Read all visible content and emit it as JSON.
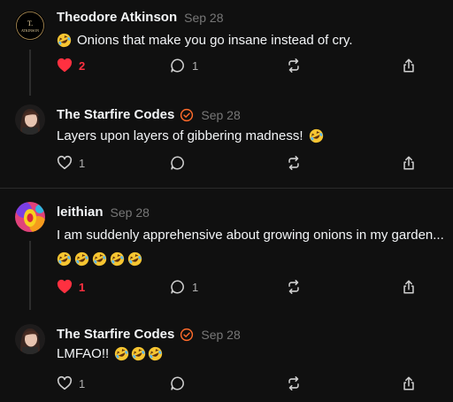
{
  "posts": [
    {
      "author": "Theodore Atkinson",
      "date": "Sep 28",
      "verified": false,
      "avatar": "ta-monogram-avatar",
      "text_prefix_emoji": true,
      "text": "Onions that make you go insane instead of cry.",
      "likes": "2",
      "liked": true,
      "replies": "1",
      "reposts": "",
      "extra_emojis": 0
    },
    {
      "author": "The Starfire Codes",
      "date": "Sep 28",
      "verified": true,
      "avatar": "woman-photo-avatar",
      "text_prefix_emoji": false,
      "text": "Layers upon layers of gibbering madness!",
      "likes": "1",
      "liked": false,
      "replies": "",
      "reposts": "",
      "extra_emojis": 0
    },
    {
      "author": "leithian",
      "date": "Sep 28",
      "verified": false,
      "avatar": "colorful-art-avatar",
      "text_prefix_emoji": false,
      "text": "I am suddenly apprehensive about growing onions in my garden...",
      "likes": "1",
      "liked": true,
      "replies": "1",
      "reposts": "",
      "extra_emojis": 5
    },
    {
      "author": "The Starfire Codes",
      "date": "Sep 28",
      "verified": true,
      "avatar": "woman-photo-avatar",
      "text_prefix_emoji": false,
      "text": "LMFAO!!",
      "likes": "1",
      "liked": false,
      "replies": "",
      "reposts": "",
      "extra_emojis": 0
    }
  ],
  "colors": {
    "background": "#101010",
    "text": "#f3f5f7",
    "muted": "#777777",
    "like": "#ff3040",
    "verified": "#ff6b2b"
  },
  "icons": [
    "heart-icon",
    "comment-icon",
    "repost-icon",
    "share-icon",
    "verified-badge-icon",
    "rofl-emoji-icon"
  ]
}
